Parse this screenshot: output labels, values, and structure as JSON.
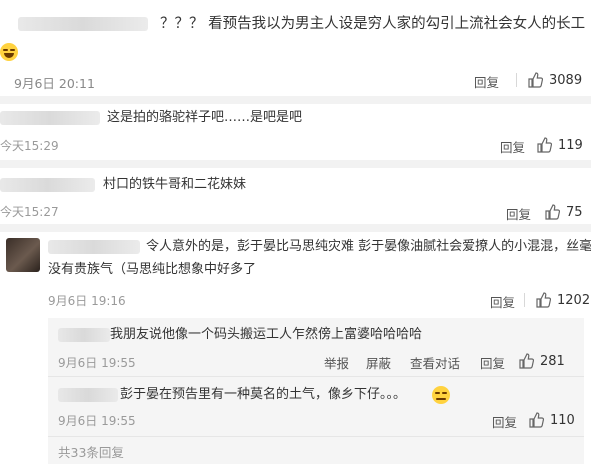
{
  "comments": [
    {
      "text": "？？？ 看预告我以为男主人设是穷人家的勾引上流社会女人的长工",
      "time": "9月6日 20:11",
      "reply_label": "回复",
      "likes": "3089",
      "emoji": "laugh-cry-emoji"
    },
    {
      "text": "这是拍的骆驼祥子吧……是吧是吧",
      "time": "今天15:29",
      "reply_label": "回复",
      "likes": "119"
    },
    {
      "text": "村口的铁牛哥和二花妹妹",
      "time": "今天15:27",
      "reply_label": "回复",
      "likes": "75"
    },
    {
      "text_line1": "令人意外的是，彭于晏比马思纯灾难  彭于晏像油腻社会爱撩人的小混混，丝毫",
      "text_line2": "没有贵族气（马思纯比想象中好多了",
      "time": "9月6日 19:16",
      "reply_label": "回复",
      "likes": "1202",
      "replies": [
        {
          "text": "我朋友说他像一个码头搬运工人乍然傍上富婆哈哈哈哈",
          "time": "9月6日 19:55",
          "report_label": "举报",
          "block_label": "屏蔽",
          "convo_label": "查看对话",
          "reply_label": "回复",
          "likes": "281"
        },
        {
          "text": "彭于晏在预告里有一种莫名的土气，像乡下仔。。。",
          "time": "9月6日 19:55",
          "reply_label": "回复",
          "likes": "110",
          "emoji": "smug-emoji"
        }
      ],
      "more_replies": "共33条回复"
    }
  ],
  "colors": {
    "accent_link": "#999999",
    "separator": "#f2f2f2",
    "sub_bg": "#f5f5f5"
  }
}
